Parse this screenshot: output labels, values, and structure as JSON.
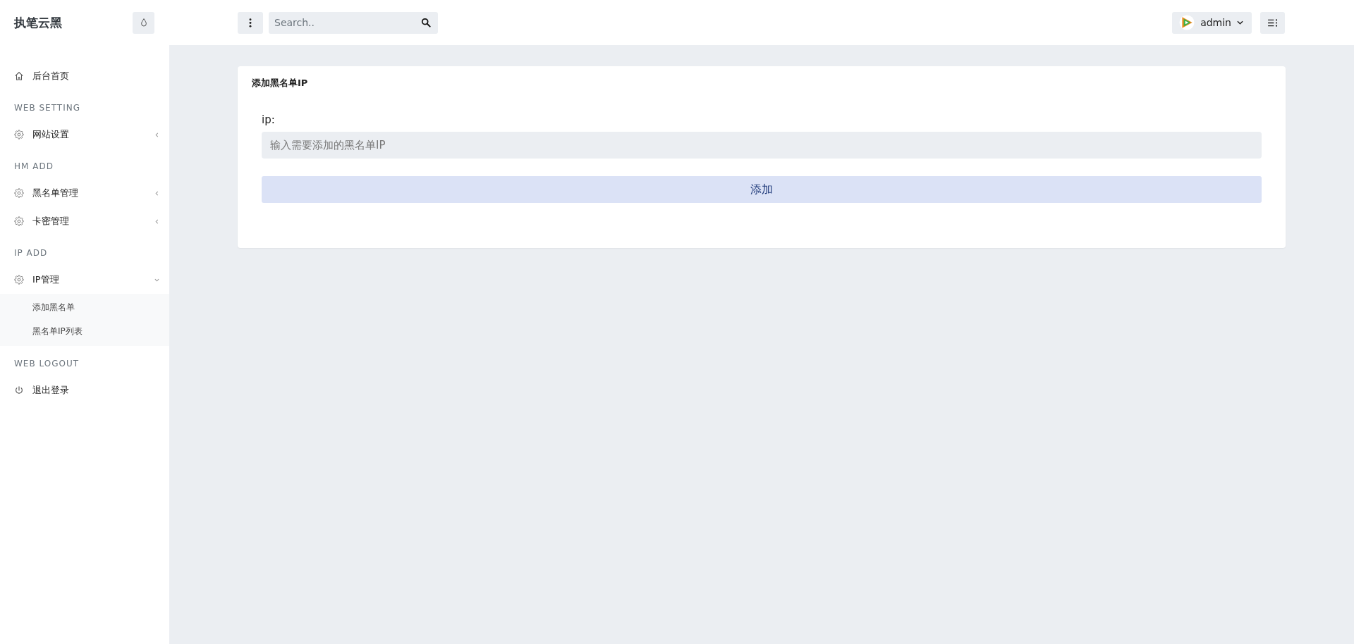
{
  "brand": "执笔云黑",
  "topbar": {
    "search": {
      "placeholder": "Search.."
    },
    "user": {
      "name": "admin"
    }
  },
  "sidebar": {
    "items": [
      {
        "kind": "home",
        "label": "后台首页"
      },
      {
        "kind": "heading",
        "label": "WEB SETTING"
      },
      {
        "kind": "menu",
        "label": "网站设置",
        "expanded": false
      },
      {
        "kind": "heading",
        "label": "HM ADD"
      },
      {
        "kind": "menu",
        "label": "黑名单管理",
        "expanded": false
      },
      {
        "kind": "menu",
        "label": "卡密管理",
        "expanded": false
      },
      {
        "kind": "heading",
        "label": "IP ADD"
      },
      {
        "kind": "menu",
        "label": "IP管理",
        "expanded": true,
        "children": [
          {
            "label": "添加黑名单"
          },
          {
            "label": "黑名单IP列表"
          }
        ]
      },
      {
        "kind": "heading",
        "label": "WEB LOGOUT"
      },
      {
        "kind": "logout",
        "label": "退出登录"
      }
    ]
  },
  "card": {
    "title": "添加黑名单IP",
    "field_label": "ip:",
    "field": {
      "placeholder": "输入需要添加的黑名单IP"
    },
    "submit": "添加"
  }
}
